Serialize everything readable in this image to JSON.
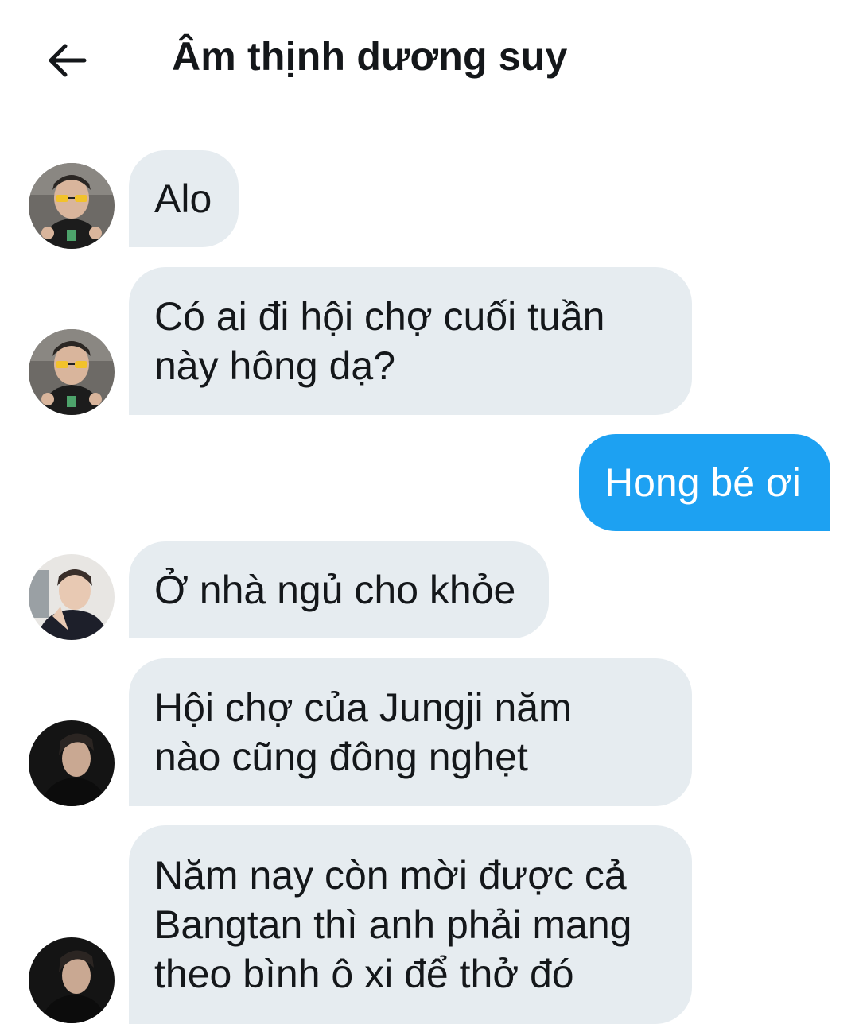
{
  "header": {
    "title": "Âm thịnh dương suy",
    "back_icon": "arrow-left-icon"
  },
  "colors": {
    "incoming_bubble": "#e6ecf0",
    "outgoing_bubble": "#1da1f2",
    "text": "#14171a"
  },
  "messages": [
    {
      "direction": "incoming",
      "sender_avatar": "avatar-glasses",
      "text": "Alo"
    },
    {
      "direction": "incoming",
      "sender_avatar": "avatar-glasses",
      "text": "Có ai đi hội chợ cuối tuần\nnày hông dạ?"
    },
    {
      "direction": "outgoing",
      "text": "Hong bé ơi"
    },
    {
      "direction": "incoming",
      "sender_avatar": "avatar-light",
      "text": "Ở nhà ngủ cho khỏe"
    },
    {
      "direction": "incoming",
      "sender_avatar": "avatar-dark",
      "text": "Hội chợ của Jungji năm\nnào cũng đông nghẹt"
    },
    {
      "direction": "incoming",
      "sender_avatar": "avatar-dark",
      "text": "Năm nay còn mời được cả\nBangtan thì anh phải mang\ntheo bình ô xi để thở đó"
    }
  ]
}
